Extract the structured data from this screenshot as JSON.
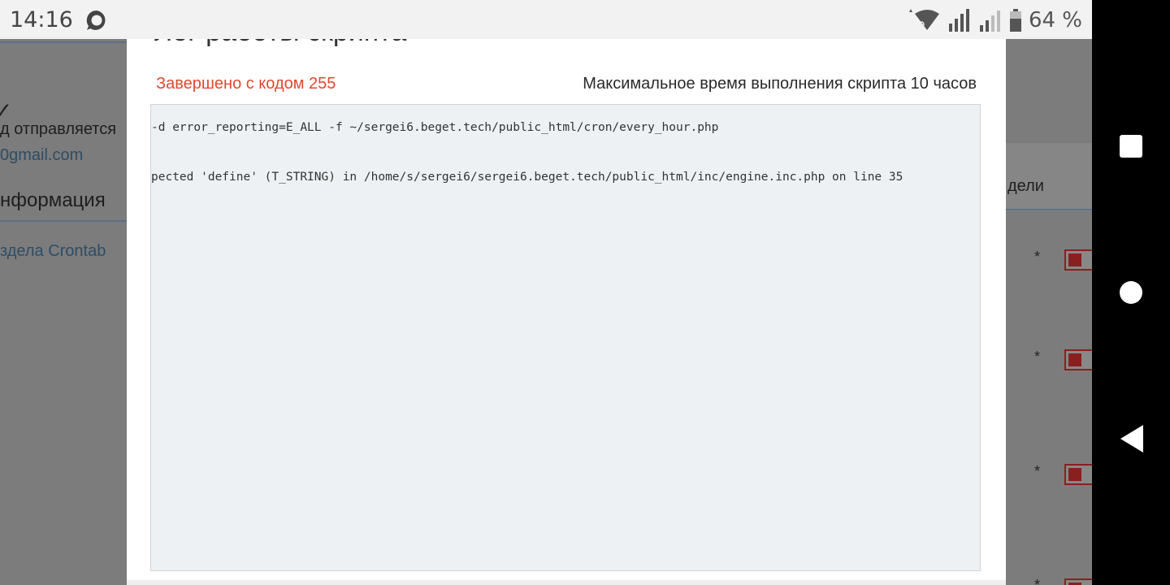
{
  "status_bar": {
    "time": "14:16",
    "battery": "64 %",
    "icons": [
      "chat-bubble-icon",
      "wifi-icon",
      "signal-icon",
      "signal-icon",
      "battery-icon"
    ]
  },
  "nav_bar": {
    "buttons": [
      "recents-square-icon",
      "home-circle-icon",
      "back-triangle-icon"
    ]
  },
  "background_page": {
    "left": {
      "text1": "д отправляется",
      "text2": "0gmail.com",
      "text3": "нформация",
      "text4": "здела Crontab"
    },
    "right": {
      "header_label": "дели",
      "rows": [
        "*",
        "*",
        "*",
        "*"
      ]
    }
  },
  "modal": {
    "title": "Лог работы скрипта",
    "exit_status": "Завершено с кодом 255",
    "max_time": "Максимальное время выполнения скрипта 10 часов",
    "log_lines": [
      "-d error_reporting=E_ALL -f ~/sergei6.beget.tech/public_html/cron/every_hour.php",
      "pected 'define' (T_STRING) in /home/s/sergei6/sergei6.beget.tech/public_html/inc/engine.inc.php on line 35"
    ]
  },
  "colors": {
    "error_red": "#e2472f",
    "overlay_gray": "#7c7c7c",
    "toggle_red": "#8a1f1f"
  }
}
